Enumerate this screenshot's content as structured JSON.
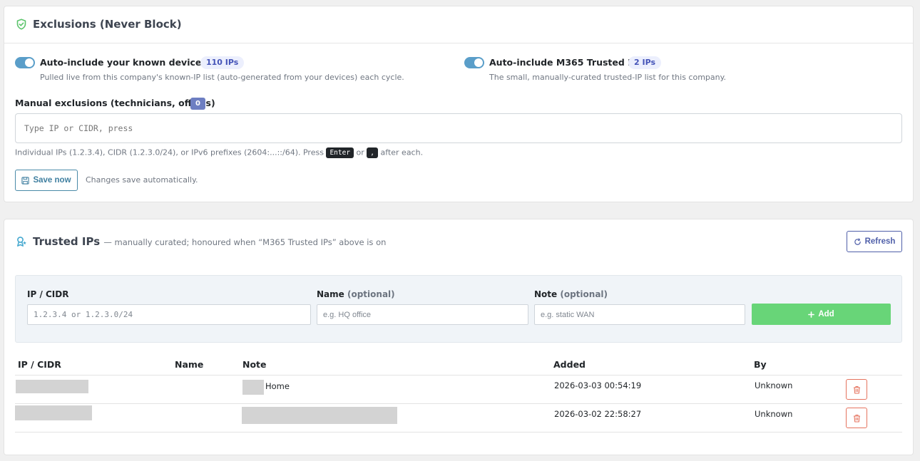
{
  "exclusions": {
    "title": "Exclusions (Never Block)",
    "known_devices": {
      "label": "Auto-include your known device IPs",
      "badge": "110 IPs",
      "description": "Pulled live from this company's known-IP list (auto-generated from your devices) each cycle."
    },
    "m365_trusted": {
      "label": "Auto-include M365 Trusted IPs",
      "badge": "2 IPs",
      "description": "The small, manually-curated trusted-IP list for this company."
    },
    "manual": {
      "label": "Manual exclusions (technicians, offices)",
      "count": "0",
      "placeholder": "Type IP or CIDR, press",
      "help_prefix": "Individual IPs (1.2.3.4), CIDR (1.2.3.0/24), or IPv6 prefixes (2604:...::/64). Press ",
      "help_key_enter": "Enter",
      "help_or": " or ",
      "help_key_comma": ",",
      "help_suffix": " after each."
    },
    "save_label": "Save now",
    "save_note": "Changes save automatically."
  },
  "trusted": {
    "title": "Trusted IPs",
    "subtitle": "— manually curated; honoured when “M365 Trusted IPs” above is on",
    "refresh_label": "Refresh",
    "form": {
      "ip_label": "IP / CIDR",
      "ip_placeholder": "1.2.3.4 or 1.2.3.0/24",
      "name_label": "Name",
      "name_optional": "(optional)",
      "name_placeholder": "e.g. HQ office",
      "note_label": "Note",
      "note_optional": "(optional)",
      "note_placeholder": "e.g. static WAN",
      "add_label": "Add"
    },
    "columns": [
      "IP / CIDR",
      "Name",
      "Note",
      "Added",
      "By"
    ],
    "rows": [
      {
        "note": "Home",
        "added": "2026-03-03 00:54:19",
        "by": "Unknown"
      },
      {
        "note": "",
        "added": "2026-03-02 22:58:27",
        "by": "Unknown"
      }
    ]
  },
  "colors": {
    "toggle_on": "#5a9ec9",
    "add_button": "#68d578",
    "delete_border": "#e5735e",
    "badge_count": "#6d7ec2"
  },
  "icons": {
    "exclusions": "shield-check-icon",
    "trusted": "award-icon",
    "save": "floppy-disk-icon",
    "refresh": "refresh-icon",
    "add": "plus-icon",
    "delete": "trash-icon"
  }
}
